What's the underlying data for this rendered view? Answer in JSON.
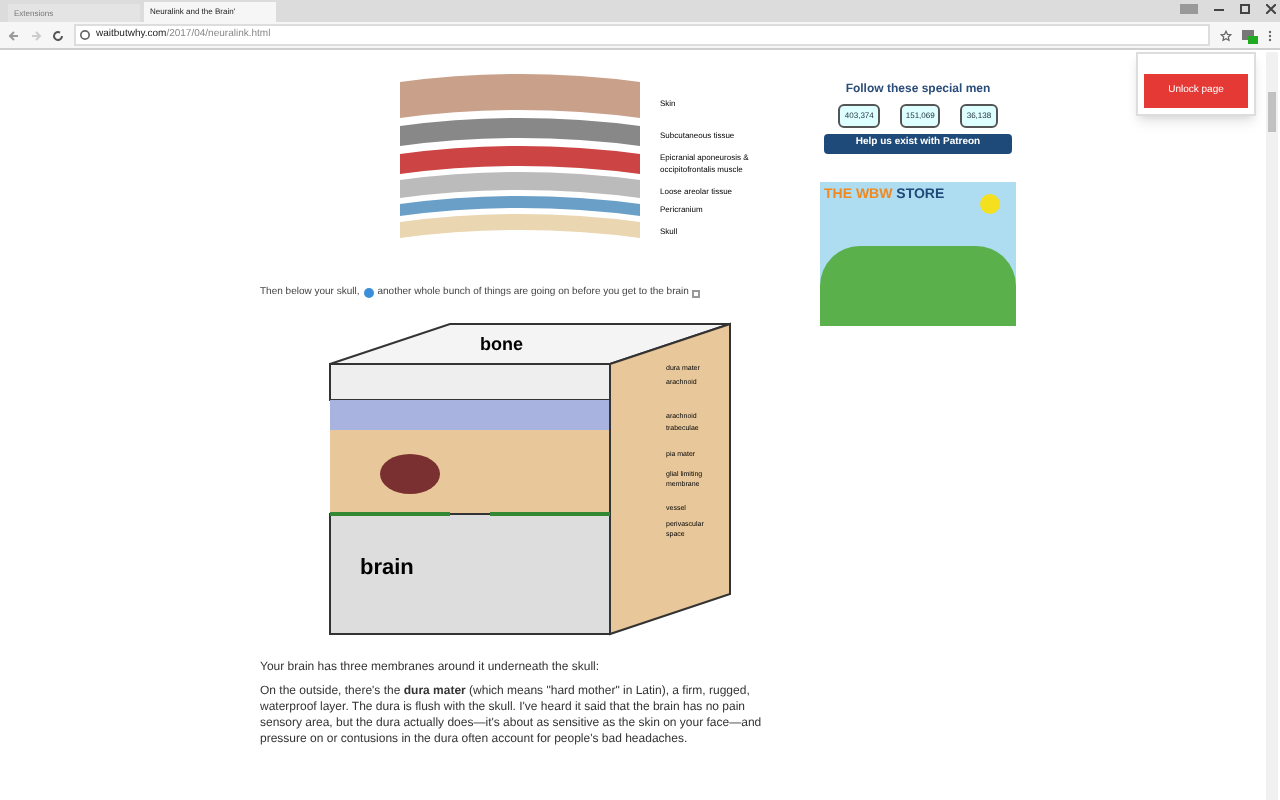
{
  "browser": {
    "tabs": [
      {
        "title": "Extensions",
        "selected": false
      },
      {
        "title": "Neuralink and the Brain'",
        "selected": true
      }
    ],
    "url_host": "waitbutwhy.com",
    "url_path": "/2017/04/neuralink.html"
  },
  "popup": {
    "button": "Unlock page"
  },
  "article": {
    "figure_skin": {
      "labels": [
        "Skin",
        "Subcutaneous tissue",
        "Epicranial aponeurosis &",
        "occipitofrontalis muscle",
        "Loose areolar tissue",
        "Pericranium",
        "Skull"
      ]
    },
    "sentence": [
      "Then below your skull,",
      "another whole bunch of things are going on before you get to the brain"
    ],
    "figure_brain": {
      "big_labels": [
        "bone",
        "brain"
      ],
      "labels": [
        "dura mater",
        "arachnoid",
        "arachnoid",
        "trabeculae",
        "pia mater",
        "glial limiting",
        "membrane",
        "vessel",
        "perivascular",
        "space"
      ]
    },
    "paragraphs": [
      "Your brain has three membranes around it underneath the skull:",
      "On the outside, there's the **dura mater** (which means \"hard mother\" in Latin), a firm, rugged, waterproof layer. The dura is flush with the skull. I've heard it said that the brain has no pain sensory area, but the dura actually does—it's about as sensitive as the skin on your face—and pressure on or contusions in the dura often account for people's bad headaches."
    ]
  },
  "sidebar": {
    "follow_title": "Follow these special men",
    "counts": [
      "403,374",
      "151,069",
      "36,138"
    ],
    "patreon": "Help us exist with Patreon",
    "store_title": [
      "THE WBW",
      "STORE"
    ]
  }
}
